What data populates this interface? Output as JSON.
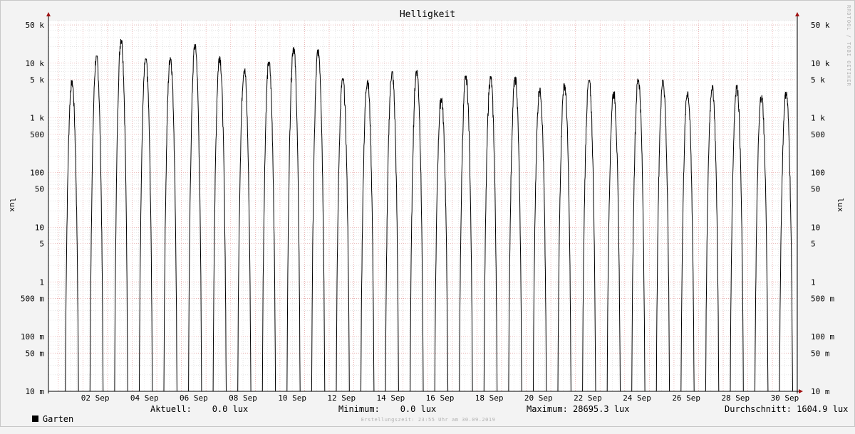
{
  "watermark": "RRDTOOL / TOBI OETIKER",
  "footer": "Erstellungszeit: 23:55 Uhr am 30.09.2019",
  "legend": {
    "series_label": "Garten",
    "current": "Aktuell:    0.0 lux",
    "minimum": "Minimum:    0.0 lux",
    "maximum": "Maximum: 28695.3 lux",
    "average": "Durchschnitt: 1604.9 lux"
  },
  "colors": {
    "background": "#f3f3f3",
    "plot_background": "#ffffff",
    "line": "#000000",
    "major_grid": "#e8a0a0",
    "minor_grid": "#d8d8d8",
    "axis_arrow": "#a01010"
  },
  "chart_data": {
    "type": "line",
    "title": "Helligkeit",
    "ylabel": "lux",
    "yscale": "log",
    "ylim": [
      0.01,
      60000
    ],
    "xlim": [
      0.6,
      30.95
    ],
    "grid": true,
    "x_ticks": [
      {
        "day": 2,
        "label": "02 Sep"
      },
      {
        "day": 4,
        "label": "04 Sep"
      },
      {
        "day": 6,
        "label": "06 Sep"
      },
      {
        "day": 8,
        "label": "08 Sep"
      },
      {
        "day": 10,
        "label": "10 Sep"
      },
      {
        "day": 12,
        "label": "12 Sep"
      },
      {
        "day": 14,
        "label": "14 Sep"
      },
      {
        "day": 16,
        "label": "16 Sep"
      },
      {
        "day": 18,
        "label": "18 Sep"
      },
      {
        "day": 20,
        "label": "20 Sep"
      },
      {
        "day": 22,
        "label": "22 Sep"
      },
      {
        "day": 24,
        "label": "24 Sep"
      },
      {
        "day": 26,
        "label": "26 Sep"
      },
      {
        "day": 28,
        "label": "28 Sep"
      },
      {
        "day": 30,
        "label": "30 Sep"
      }
    ],
    "y_ticks": [
      {
        "v": 50000,
        "label": "50 k"
      },
      {
        "v": 10000,
        "label": "10 k"
      },
      {
        "v": 5000,
        "label": "5 k"
      },
      {
        "v": 1000,
        "label": "1 k"
      },
      {
        "v": 500,
        "label": "500"
      },
      {
        "v": 100,
        "label": "100"
      },
      {
        "v": 50,
        "label": "50"
      },
      {
        "v": 10,
        "label": "10"
      },
      {
        "v": 5,
        "label": "5"
      },
      {
        "v": 1,
        "label": "1"
      },
      {
        "v": 0.5,
        "label": "500 m"
      },
      {
        "v": 0.1,
        "label": "100 m"
      },
      {
        "v": 0.05,
        "label": "50 m"
      },
      {
        "v": 0.01,
        "label": "10 m"
      }
    ],
    "series": [
      {
        "name": "Garten",
        "daily_peaks_lux": [
          {
            "day": 1,
            "peak": 4800
          },
          {
            "day": 2,
            "peak": 13500
          },
          {
            "day": 3,
            "peak": 28695.3
          },
          {
            "day": 4,
            "peak": 12000
          },
          {
            "day": 5,
            "peak": 13000
          },
          {
            "day": 6,
            "peak": 22000
          },
          {
            "day": 7,
            "peak": 13500
          },
          {
            "day": 8,
            "peak": 8000
          },
          {
            "day": 9,
            "peak": 10500
          },
          {
            "day": 10,
            "peak": 20000
          },
          {
            "day": 11,
            "peak": 17500
          },
          {
            "day": 12,
            "peak": 5200
          },
          {
            "day": 13,
            "peak": 5000
          },
          {
            "day": 14,
            "peak": 7000
          },
          {
            "day": 15,
            "peak": 7500
          },
          {
            "day": 16,
            "peak": 2300
          },
          {
            "day": 17,
            "peak": 5800
          },
          {
            "day": 18,
            "peak": 5700
          },
          {
            "day": 19,
            "peak": 5500
          },
          {
            "day": 20,
            "peak": 3500
          },
          {
            "day": 21,
            "peak": 4200
          },
          {
            "day": 22,
            "peak": 4800
          },
          {
            "day": 23,
            "peak": 3000
          },
          {
            "day": 24,
            "peak": 5200
          },
          {
            "day": 25,
            "peak": 5000
          },
          {
            "day": 26,
            "peak": 3000
          },
          {
            "day": 27,
            "peak": 3900
          },
          {
            "day": 28,
            "peak": 4000
          },
          {
            "day": 29,
            "peak": 2600
          },
          {
            "day": 30,
            "peak": 3000
          }
        ],
        "sunrise_hour": 7,
        "sunset_hour": 19.5,
        "night_value_lux": 0
      }
    ]
  }
}
